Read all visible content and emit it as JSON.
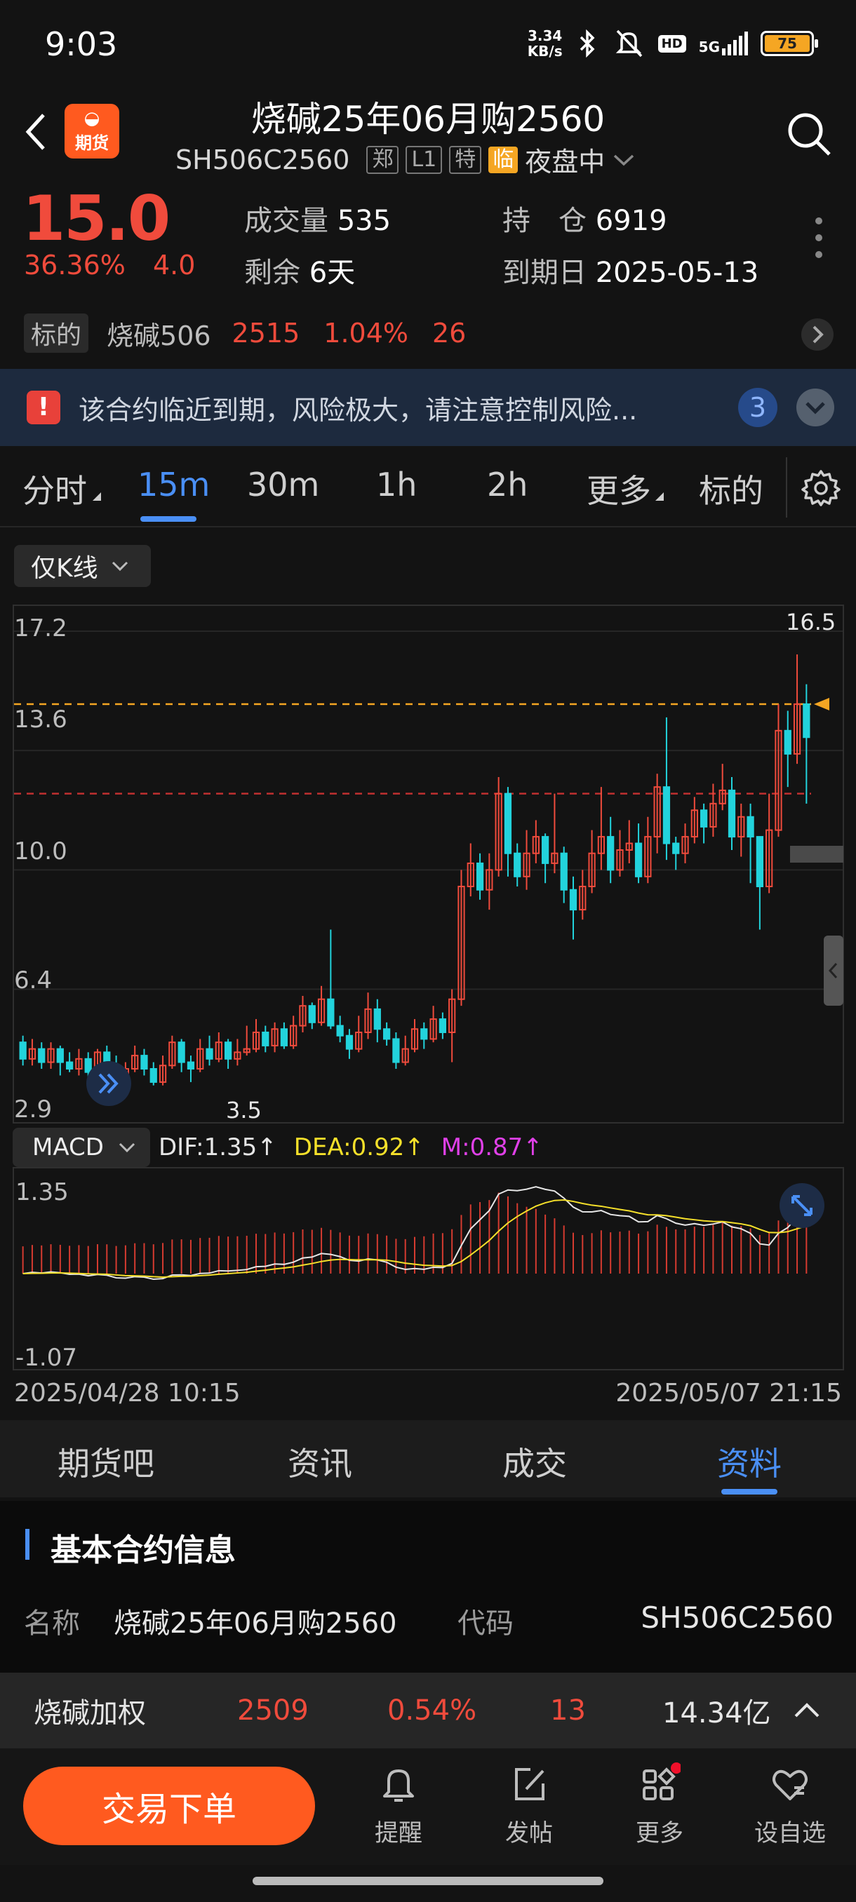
{
  "status": {
    "time": "9:03",
    "net_speed_value": "3.34",
    "net_speed_unit": "KB/s",
    "hd": "HD",
    "signal": "5G",
    "battery": "75"
  },
  "header": {
    "logo_text": "期货",
    "title": "烧碱25年06月购2560",
    "code": "SH506C2560",
    "tags": [
      "郑",
      "L1",
      "特"
    ],
    "tag_temp": "临",
    "session": "夜盘中"
  },
  "quote": {
    "last_price": "15.0",
    "change_pct": "36.36%",
    "change": "4.0",
    "volume_label": "成交量",
    "volume": "535",
    "open_interest_label": "持　仓",
    "open_interest": "6919",
    "remaining_label": "剩余",
    "remaining": "6天",
    "expiry_label": "到期日",
    "expiry": "2025-05-13"
  },
  "underlying": {
    "label": "标的",
    "name": "烧碱506",
    "price": "2515",
    "pct": "1.04%",
    "change": "26"
  },
  "alert": {
    "icon": "!",
    "text": "该合约临近到期，风险极大，请注意控制风险...",
    "count": "3"
  },
  "period_tabs": [
    "分时",
    "15m",
    "30m",
    "1h",
    "2h",
    "更多",
    "标的"
  ],
  "active_period": "15m",
  "kline_select": "仅K线",
  "chart_data": [
    {
      "type": "candlestick",
      "y_ticks": [
        "17.2",
        "13.6",
        "10.0",
        "6.4",
        "2.9"
      ],
      "ylim": [
        2.9,
        17.2
      ],
      "max_label": "16.5",
      "min_label": "3.5",
      "reference_lines": [
        {
          "value": 15.0,
          "color": "#f5a623"
        },
        {
          "value": 12.3,
          "color": "#c03030"
        }
      ],
      "candles": [
        [
          4.8,
          4.3,
          5.0,
          4.1
        ],
        [
          4.3,
          4.6,
          4.9,
          4.1
        ],
        [
          4.6,
          4.2,
          4.8,
          4.0
        ],
        [
          4.2,
          4.6,
          4.8,
          4.0
        ],
        [
          4.6,
          4.2,
          4.7,
          3.8
        ],
        [
          4.2,
          4.0,
          4.5,
          3.9
        ],
        [
          4.0,
          4.3,
          4.6,
          3.8
        ],
        [
          4.3,
          3.9,
          4.5,
          3.7
        ],
        [
          3.9,
          4.5,
          4.6,
          3.7
        ],
        [
          4.5,
          4.1,
          4.7,
          3.8
        ],
        [
          4.1,
          3.6,
          4.4,
          3.5
        ],
        [
          3.6,
          4.0,
          4.2,
          3.5
        ],
        [
          4.0,
          4.4,
          4.7,
          3.9
        ],
        [
          4.4,
          4.0,
          4.6,
          3.8
        ],
        [
          4.0,
          3.6,
          4.2,
          3.5
        ],
        [
          3.6,
          4.1,
          4.4,
          3.5
        ],
        [
          4.1,
          4.8,
          5.0,
          4.0
        ],
        [
          4.8,
          4.2,
          4.9,
          3.9
        ],
        [
          4.2,
          4.0,
          4.4,
          3.6
        ],
        [
          4.0,
          4.6,
          4.9,
          3.9
        ],
        [
          4.6,
          4.3,
          5.0,
          4.1
        ],
        [
          4.3,
          4.8,
          5.1,
          4.2
        ],
        [
          4.8,
          4.3,
          4.9,
          4.0
        ],
        [
          4.3,
          4.5,
          4.9,
          4.1
        ],
        [
          4.5,
          4.6,
          5.3,
          4.4
        ],
        [
          4.6,
          5.1,
          5.5,
          4.5
        ],
        [
          5.1,
          4.7,
          5.3,
          4.5
        ],
        [
          4.7,
          5.2,
          5.4,
          4.5
        ],
        [
          5.2,
          4.7,
          5.4,
          4.6
        ],
        [
          4.7,
          5.3,
          5.6,
          4.6
        ],
        [
          5.3,
          5.9,
          6.2,
          5.1
        ],
        [
          5.9,
          5.4,
          6.0,
          5.2
        ],
        [
          5.4,
          6.1,
          6.5,
          5.3
        ],
        [
          6.1,
          5.3,
          8.2,
          5.2
        ],
        [
          5.3,
          5.0,
          5.6,
          4.8
        ],
        [
          5.0,
          4.6,
          5.2,
          4.3
        ],
        [
          4.6,
          5.1,
          5.6,
          4.5
        ],
        [
          5.1,
          5.8,
          6.3,
          4.9
        ],
        [
          5.8,
          5.2,
          6.1,
          4.8
        ],
        [
          5.2,
          4.9,
          5.4,
          4.7
        ],
        [
          4.9,
          4.2,
          5.1,
          4.0
        ],
        [
          4.2,
          4.6,
          5.0,
          4.1
        ],
        [
          4.6,
          5.2,
          5.5,
          4.5
        ],
        [
          5.2,
          4.9,
          5.4,
          4.6
        ],
        [
          4.9,
          5.5,
          5.9,
          4.8
        ],
        [
          5.5,
          5.1,
          5.7,
          4.9
        ],
        [
          5.1,
          6.1,
          6.4,
          4.2
        ],
        [
          6.1,
          9.5,
          10.0,
          5.9
        ],
        [
          9.5,
          10.2,
          10.8,
          9.2
        ],
        [
          10.2,
          9.4,
          10.5,
          9.1
        ],
        [
          9.4,
          10.0,
          10.5,
          8.8
        ],
        [
          10.0,
          12.3,
          12.8,
          9.8
        ],
        [
          12.3,
          10.5,
          12.5,
          9.8
        ],
        [
          10.5,
          9.8,
          10.8,
          9.5
        ],
        [
          9.8,
          10.5,
          11.2,
          9.4
        ],
        [
          10.5,
          11.0,
          11.5,
          10.2
        ],
        [
          11.0,
          10.2,
          11.1,
          9.6
        ],
        [
          10.2,
          10.5,
          12.3,
          9.9
        ],
        [
          10.5,
          9.4,
          10.7,
          9.0
        ],
        [
          9.4,
          8.8,
          9.8,
          7.9
        ],
        [
          8.8,
          9.5,
          10.0,
          8.5
        ],
        [
          9.5,
          10.5,
          11.2,
          9.3
        ],
        [
          10.5,
          11.0,
          12.5,
          10.0
        ],
        [
          11.0,
          10.0,
          11.6,
          9.6
        ],
        [
          10.0,
          10.6,
          11.2,
          9.8
        ],
        [
          10.6,
          10.8,
          11.5,
          10.2
        ],
        [
          10.8,
          9.8,
          11.4,
          9.6
        ],
        [
          9.8,
          11.0,
          11.6,
          9.6
        ],
        [
          11.0,
          12.5,
          12.9,
          10.5
        ],
        [
          12.5,
          10.8,
          14.6,
          10.3
        ],
        [
          10.8,
          10.5,
          11.0,
          10.0
        ],
        [
          10.5,
          11.0,
          11.4,
          10.2
        ],
        [
          11.0,
          11.8,
          12.2,
          10.8
        ],
        [
          11.8,
          11.3,
          12.0,
          10.8
        ],
        [
          11.3,
          12.0,
          12.6,
          11.0
        ],
        [
          12.0,
          12.4,
          13.2,
          11.8
        ],
        [
          12.4,
          11.0,
          12.8,
          10.6
        ],
        [
          11.0,
          11.6,
          12.0,
          10.4
        ],
        [
          11.6,
          11.0,
          12.0,
          9.6
        ],
        [
          11.0,
          9.5,
          10.2,
          8.2
        ],
        [
          9.5,
          11.2,
          12.3,
          9.3
        ],
        [
          11.2,
          14.2,
          15.0,
          11.0
        ],
        [
          14.2,
          13.5,
          14.8,
          12.5
        ],
        [
          13.5,
          15.0,
          16.5,
          13.2
        ],
        [
          15.0,
          14.0,
          15.6,
          12.0
        ]
      ]
    },
    {
      "type": "macd",
      "indicator": "MACD",
      "dif": "DIF:1.35",
      "dea": "DEA:0.92",
      "m": "M:0.87",
      "y_ticks": [
        "1.35",
        "-1.07"
      ],
      "ylim": [
        -1.07,
        1.35
      ]
    }
  ],
  "dates": {
    "start": "2025/04/28 10:15",
    "end": "2025/05/07 21:15"
  },
  "bottom_tabs": [
    "期货吧",
    "资讯",
    "成交",
    "资料"
  ],
  "active_bottom_tab": "资料",
  "section": {
    "title": "基本合约信息",
    "name_label": "名称",
    "name_value": "烧碱25年06月购2560",
    "code_label": "代码",
    "code_value": "SH506C2560"
  },
  "ticker": {
    "name": "烧碱加权",
    "price": "2509",
    "pct": "0.54%",
    "change": "13",
    "amount": "14.34亿"
  },
  "nav": {
    "trade": "交易下单",
    "items": [
      "提醒",
      "发帖",
      "更多",
      "设自选"
    ]
  }
}
